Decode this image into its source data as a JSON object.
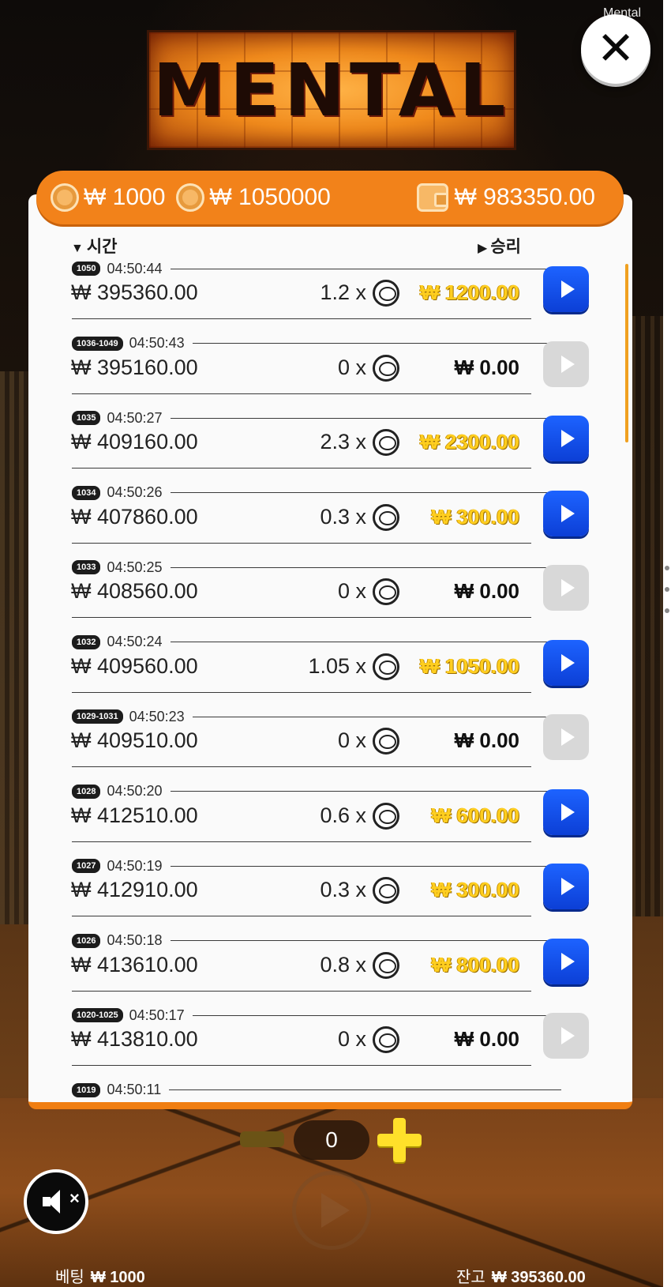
{
  "watermark": "Mental",
  "logo_text": "MENTAL",
  "close_label": "✕",
  "stats": {
    "bet": "₩ 1000",
    "max_win": "₩ 1050000",
    "balance": "₩ 983350.00"
  },
  "columns": {
    "time": "시간",
    "win": "승리"
  },
  "rows": [
    {
      "badge": "1050",
      "time": "04:50:44",
      "balance": "₩ 395360.00",
      "mult": "1.2 x",
      "win": "₩ 1200.00",
      "won": true
    },
    {
      "badge": "1036-1049",
      "time": "04:50:43",
      "balance": "₩ 395160.00",
      "mult": "0 x",
      "win": "₩ 0.00",
      "won": false
    },
    {
      "badge": "1035",
      "time": "04:50:27",
      "balance": "₩ 409160.00",
      "mult": "2.3 x",
      "win": "₩ 2300.00",
      "won": true
    },
    {
      "badge": "1034",
      "time": "04:50:26",
      "balance": "₩ 407860.00",
      "mult": "0.3 x",
      "win": "₩ 300.00",
      "won": true
    },
    {
      "badge": "1033",
      "time": "04:50:25",
      "balance": "₩ 408560.00",
      "mult": "0 x",
      "win": "₩ 0.00",
      "won": false
    },
    {
      "badge": "1032",
      "time": "04:50:24",
      "balance": "₩ 409560.00",
      "mult": "1.05 x",
      "win": "₩ 1050.00",
      "won": true
    },
    {
      "badge": "1029-1031",
      "time": "04:50:23",
      "balance": "₩ 409510.00",
      "mult": "0 x",
      "win": "₩ 0.00",
      "won": false
    },
    {
      "badge": "1028",
      "time": "04:50:20",
      "balance": "₩ 412510.00",
      "mult": "0.6 x",
      "win": "₩ 600.00",
      "won": true
    },
    {
      "badge": "1027",
      "time": "04:50:19",
      "balance": "₩ 412910.00",
      "mult": "0.3 x",
      "win": "₩ 300.00",
      "won": true
    },
    {
      "badge": "1026",
      "time": "04:50:18",
      "balance": "₩ 413610.00",
      "mult": "0.8 x",
      "win": "₩ 800.00",
      "won": true
    },
    {
      "badge": "1020-1025",
      "time": "04:50:17",
      "balance": "₩ 413810.00",
      "mult": "0 x",
      "win": "₩ 0.00",
      "won": false
    },
    {
      "badge": "1019",
      "time": "04:50:11",
      "balance": "",
      "mult": "",
      "win": "",
      "won": true
    }
  ],
  "quantity": "0",
  "footer": {
    "bet_label": "베팅",
    "bet_value": "₩ 1000",
    "balance_label": "잔고",
    "balance_value": "₩ 395360.00"
  },
  "colors": {
    "accent_orange": "#f2821a",
    "win_gold": "#ffce1f",
    "replay_blue": "#1d63ff"
  }
}
